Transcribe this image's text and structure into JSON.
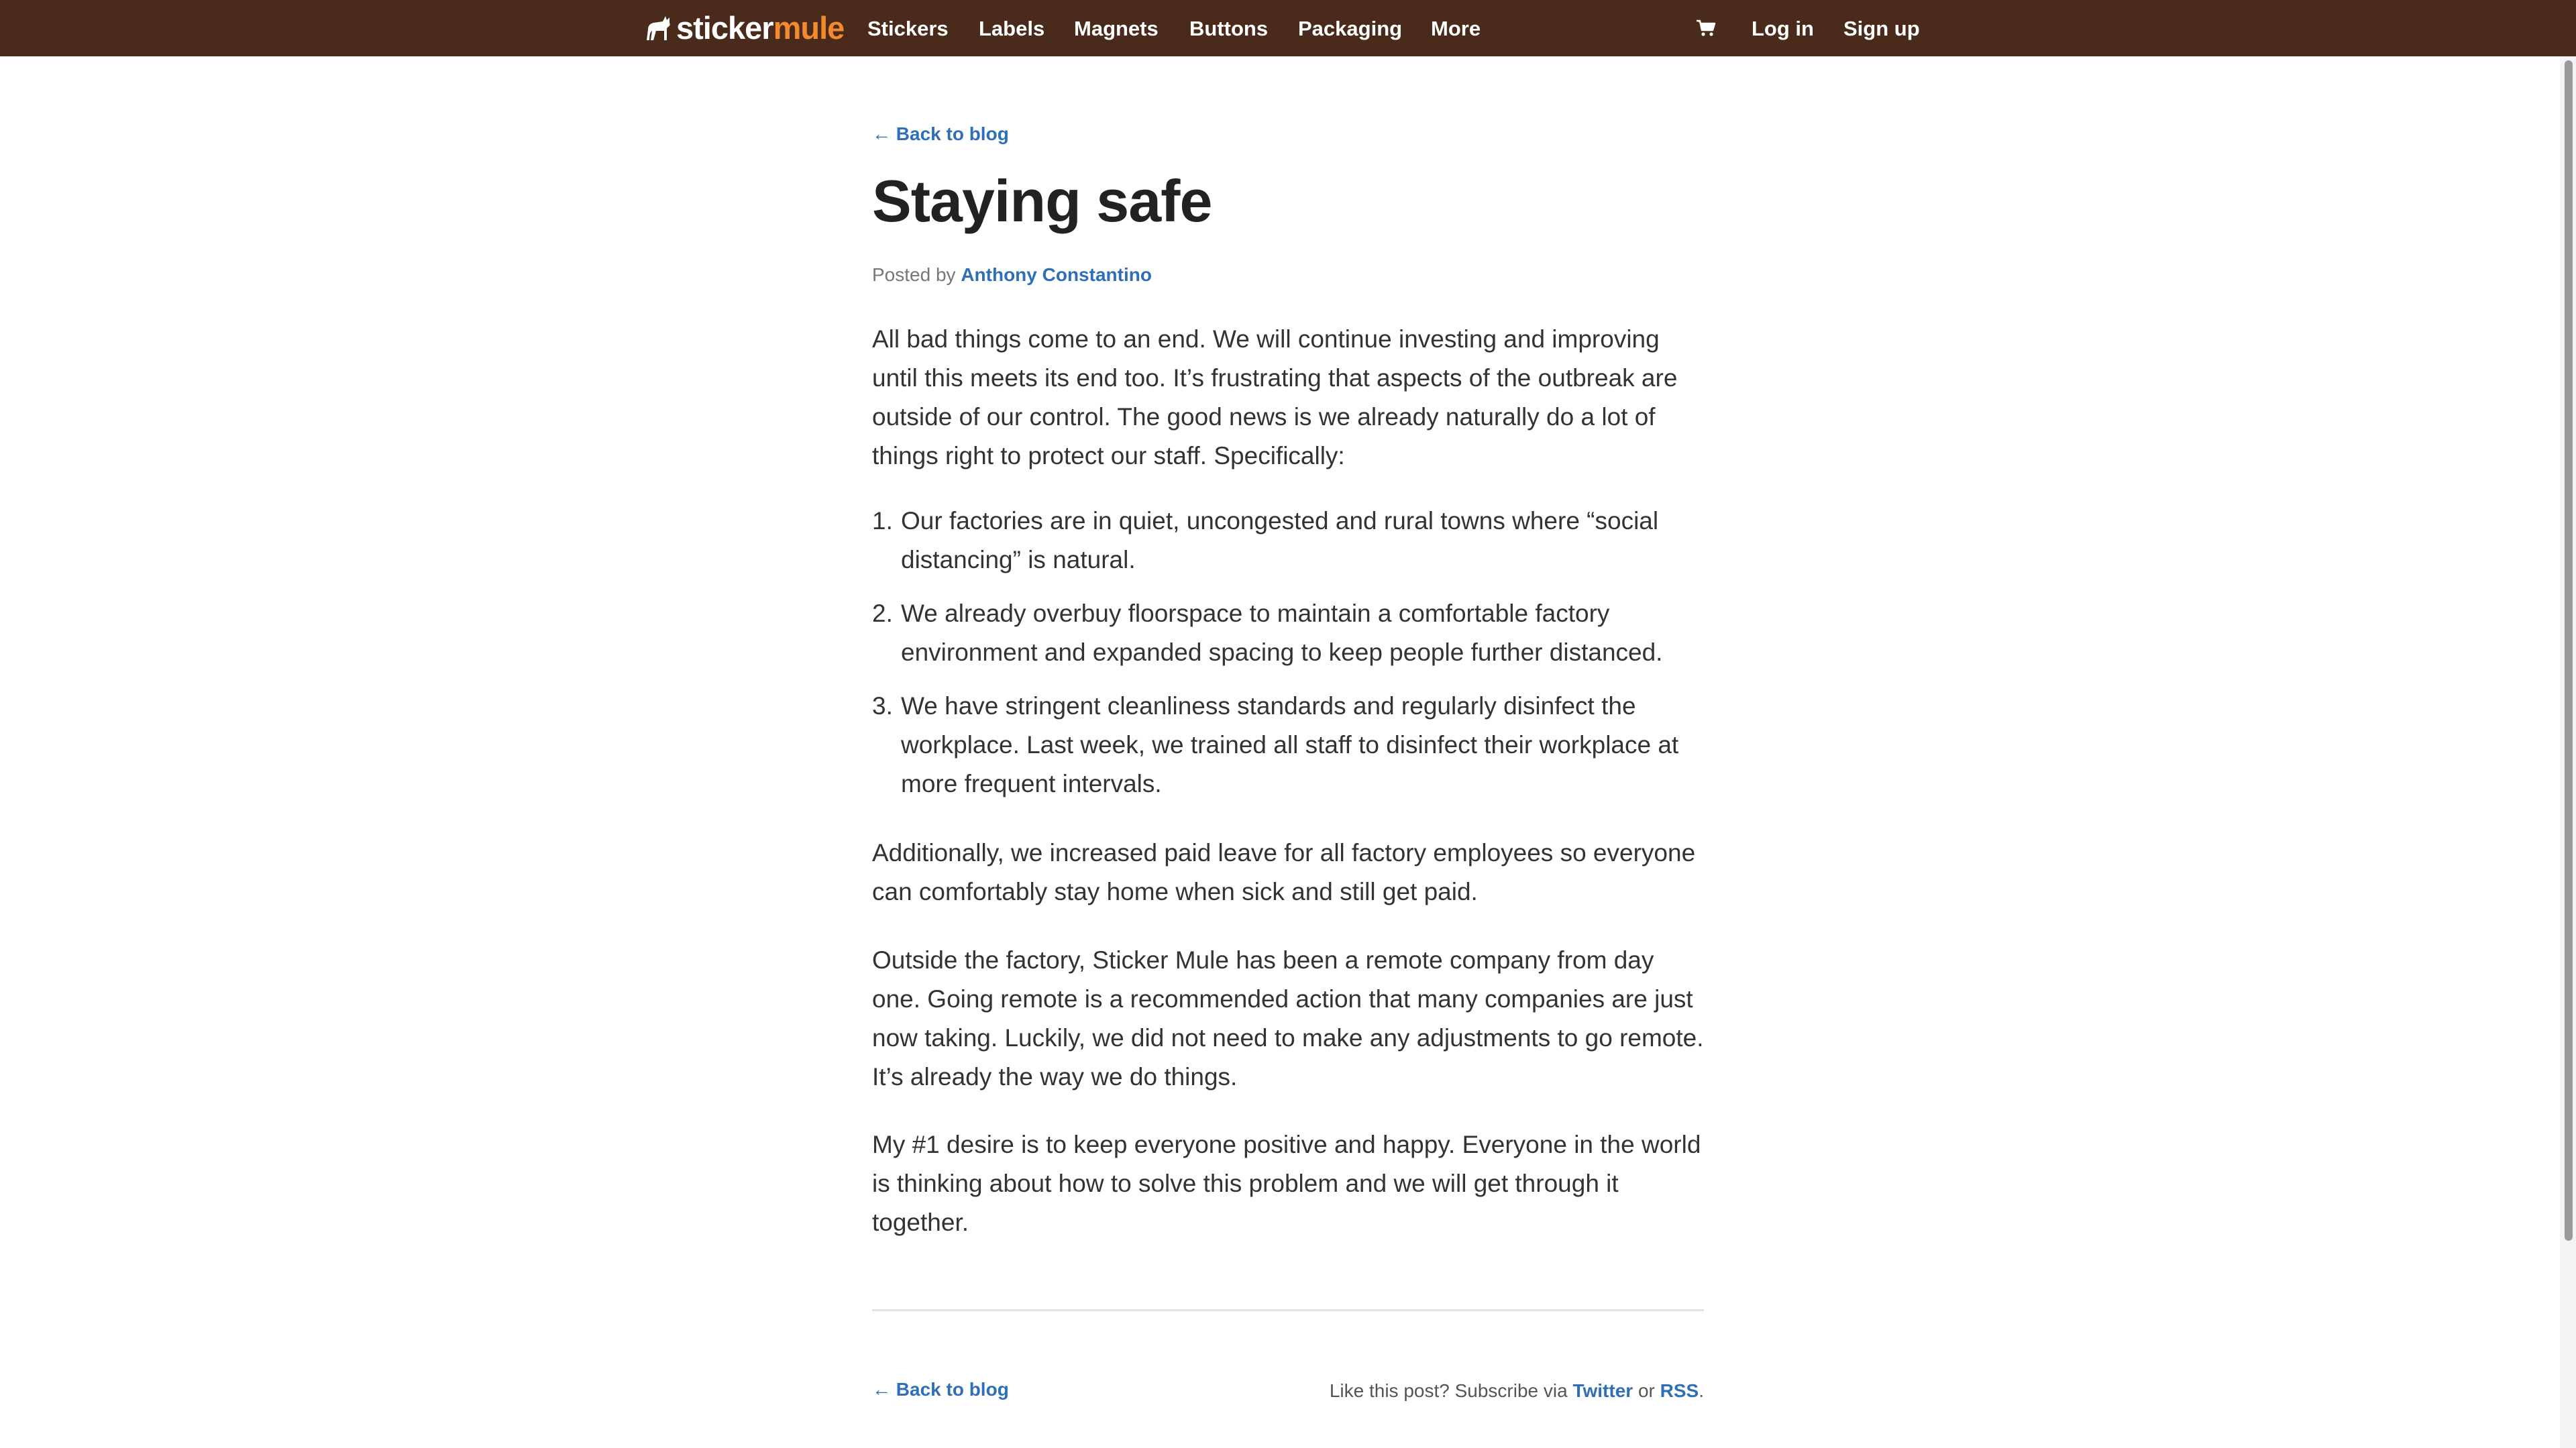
{
  "nav": {
    "logo_part1": "sticker",
    "logo_part2": "mule",
    "items": [
      {
        "label": "Stickers"
      },
      {
        "label": "Labels"
      },
      {
        "label": "Magnets"
      },
      {
        "label": "Buttons"
      },
      {
        "label": "Packaging"
      },
      {
        "label": "More"
      }
    ],
    "login_label": "Log in",
    "signup_label": "Sign up",
    "cart_icon": "cart-icon",
    "bg_color": "#4a2a1a",
    "accent_color": "#f28a2e"
  },
  "article": {
    "back_label": "← Back to blog",
    "title": "Staying safe",
    "byline_prefix": "Posted by",
    "author": "Anthony Constantino",
    "intro": "All bad things come to an end. We will continue investing and improving until this meets its end too. It’s frustrating that aspects of the outbreak are outside of our control. The good news is we already naturally do a lot of things right to protect our staff. Specifically:",
    "list": [
      {
        "num": "1.",
        "text": "Our factories are in quiet, uncongested and rural towns where “social distancing” is natural."
      },
      {
        "num": "2.",
        "text": "We already overbuy floorspace to maintain a comfortable factory environment and expanded spacing to keep people further distanced."
      },
      {
        "num": "3.",
        "text": "We have stringent cleanliness standards and regularly disinfect the workplace. Last week, we trained all staff to disinfect their workplace at more frequent intervals."
      }
    ],
    "paragraph2": "Additionally, we increased paid leave for all factory employees so everyone can comfortably stay home when sick and still get paid.",
    "paragraph3": "Outside the factory, Sticker Mule has been a remote company from day one. Going remote is a recommended action that many companies are just now taking. Luckily, we did not need to make any adjustments to go remote. It’s already the way we do things.",
    "paragraph4": "My #1 desire is to keep everyone positive and happy. Everyone in the world is thinking about how to solve this problem and we will get through it together.",
    "link_color": "#2f6fb5"
  },
  "footer": {
    "back_label": "← Back to blog",
    "subscribe_prefix": "Like this post? Subscribe via",
    "twitter_label": "Twitter",
    "or_label": "or",
    "rss_label": "RSS",
    "period": "."
  }
}
